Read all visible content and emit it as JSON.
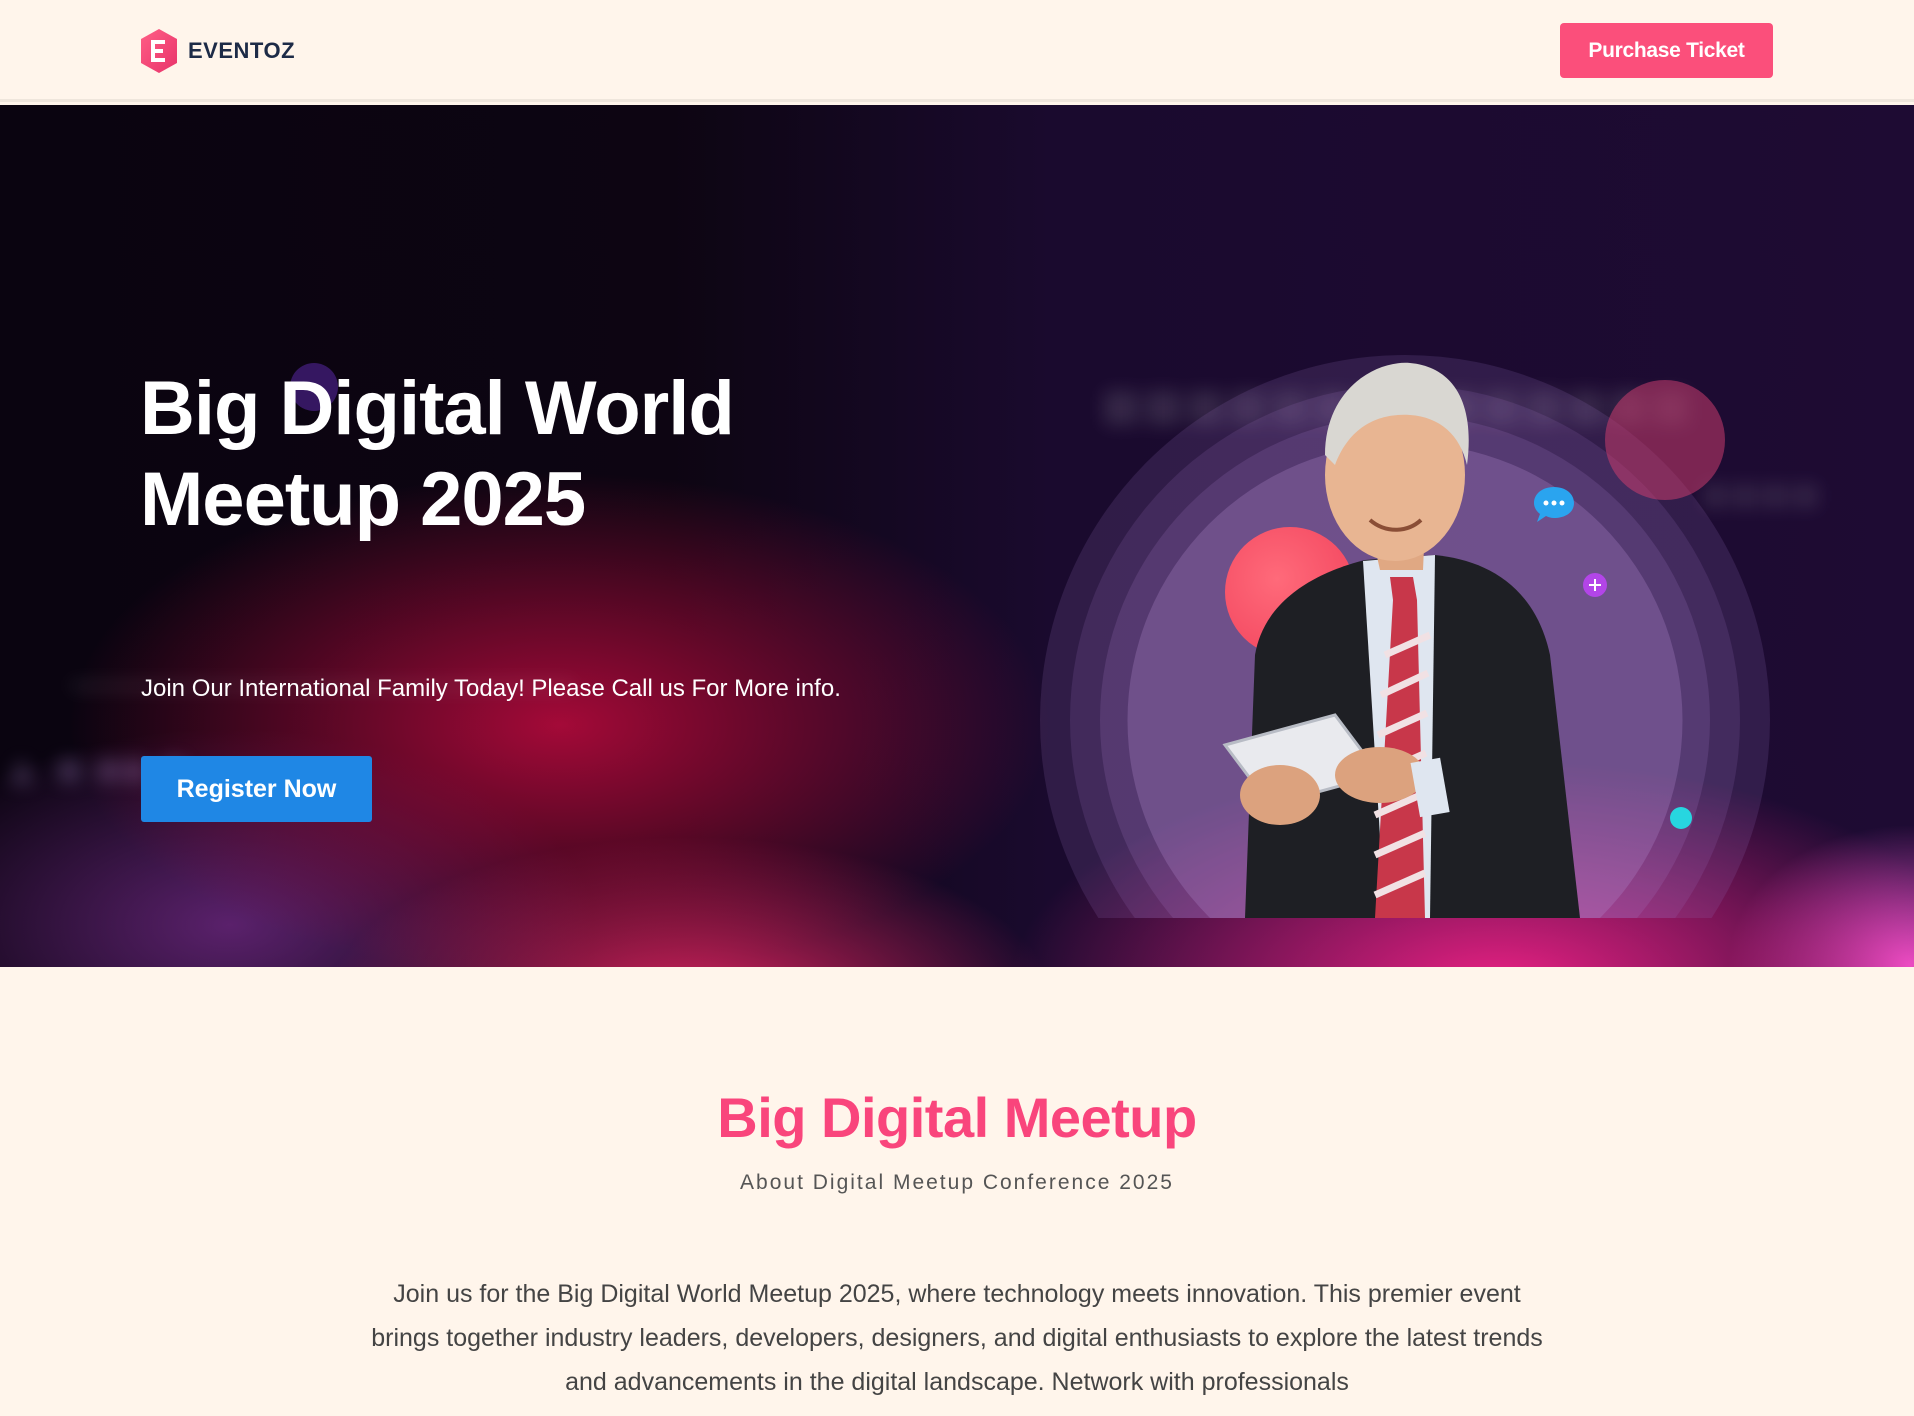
{
  "header": {
    "brand": "EVENTOZ",
    "logo_letter": "E",
    "purchase_label": "Purchase Ticket"
  },
  "hero": {
    "title_line1": "Big Digital World",
    "title_line2": "Meetup 2025",
    "subtitle": "Join Our International Family Today! Please Call us For More info.",
    "register_label": "Register Now"
  },
  "about": {
    "title": "Big Digital Meetup",
    "subtitle": "About Digital Meetup Conference 2025",
    "body": "Join us for the Big Digital World Meetup 2025, where technology meets innovation. This premier event brings together industry leaders, developers, designers, and digital enthusiasts to explore the latest trends and advancements in the digital landscape. Network with professionals"
  },
  "colors": {
    "accent": "#fb4f7b",
    "primary_button": "#1f87e5",
    "page_background": "#fff5eb",
    "brand_text": "#1d2b47"
  }
}
